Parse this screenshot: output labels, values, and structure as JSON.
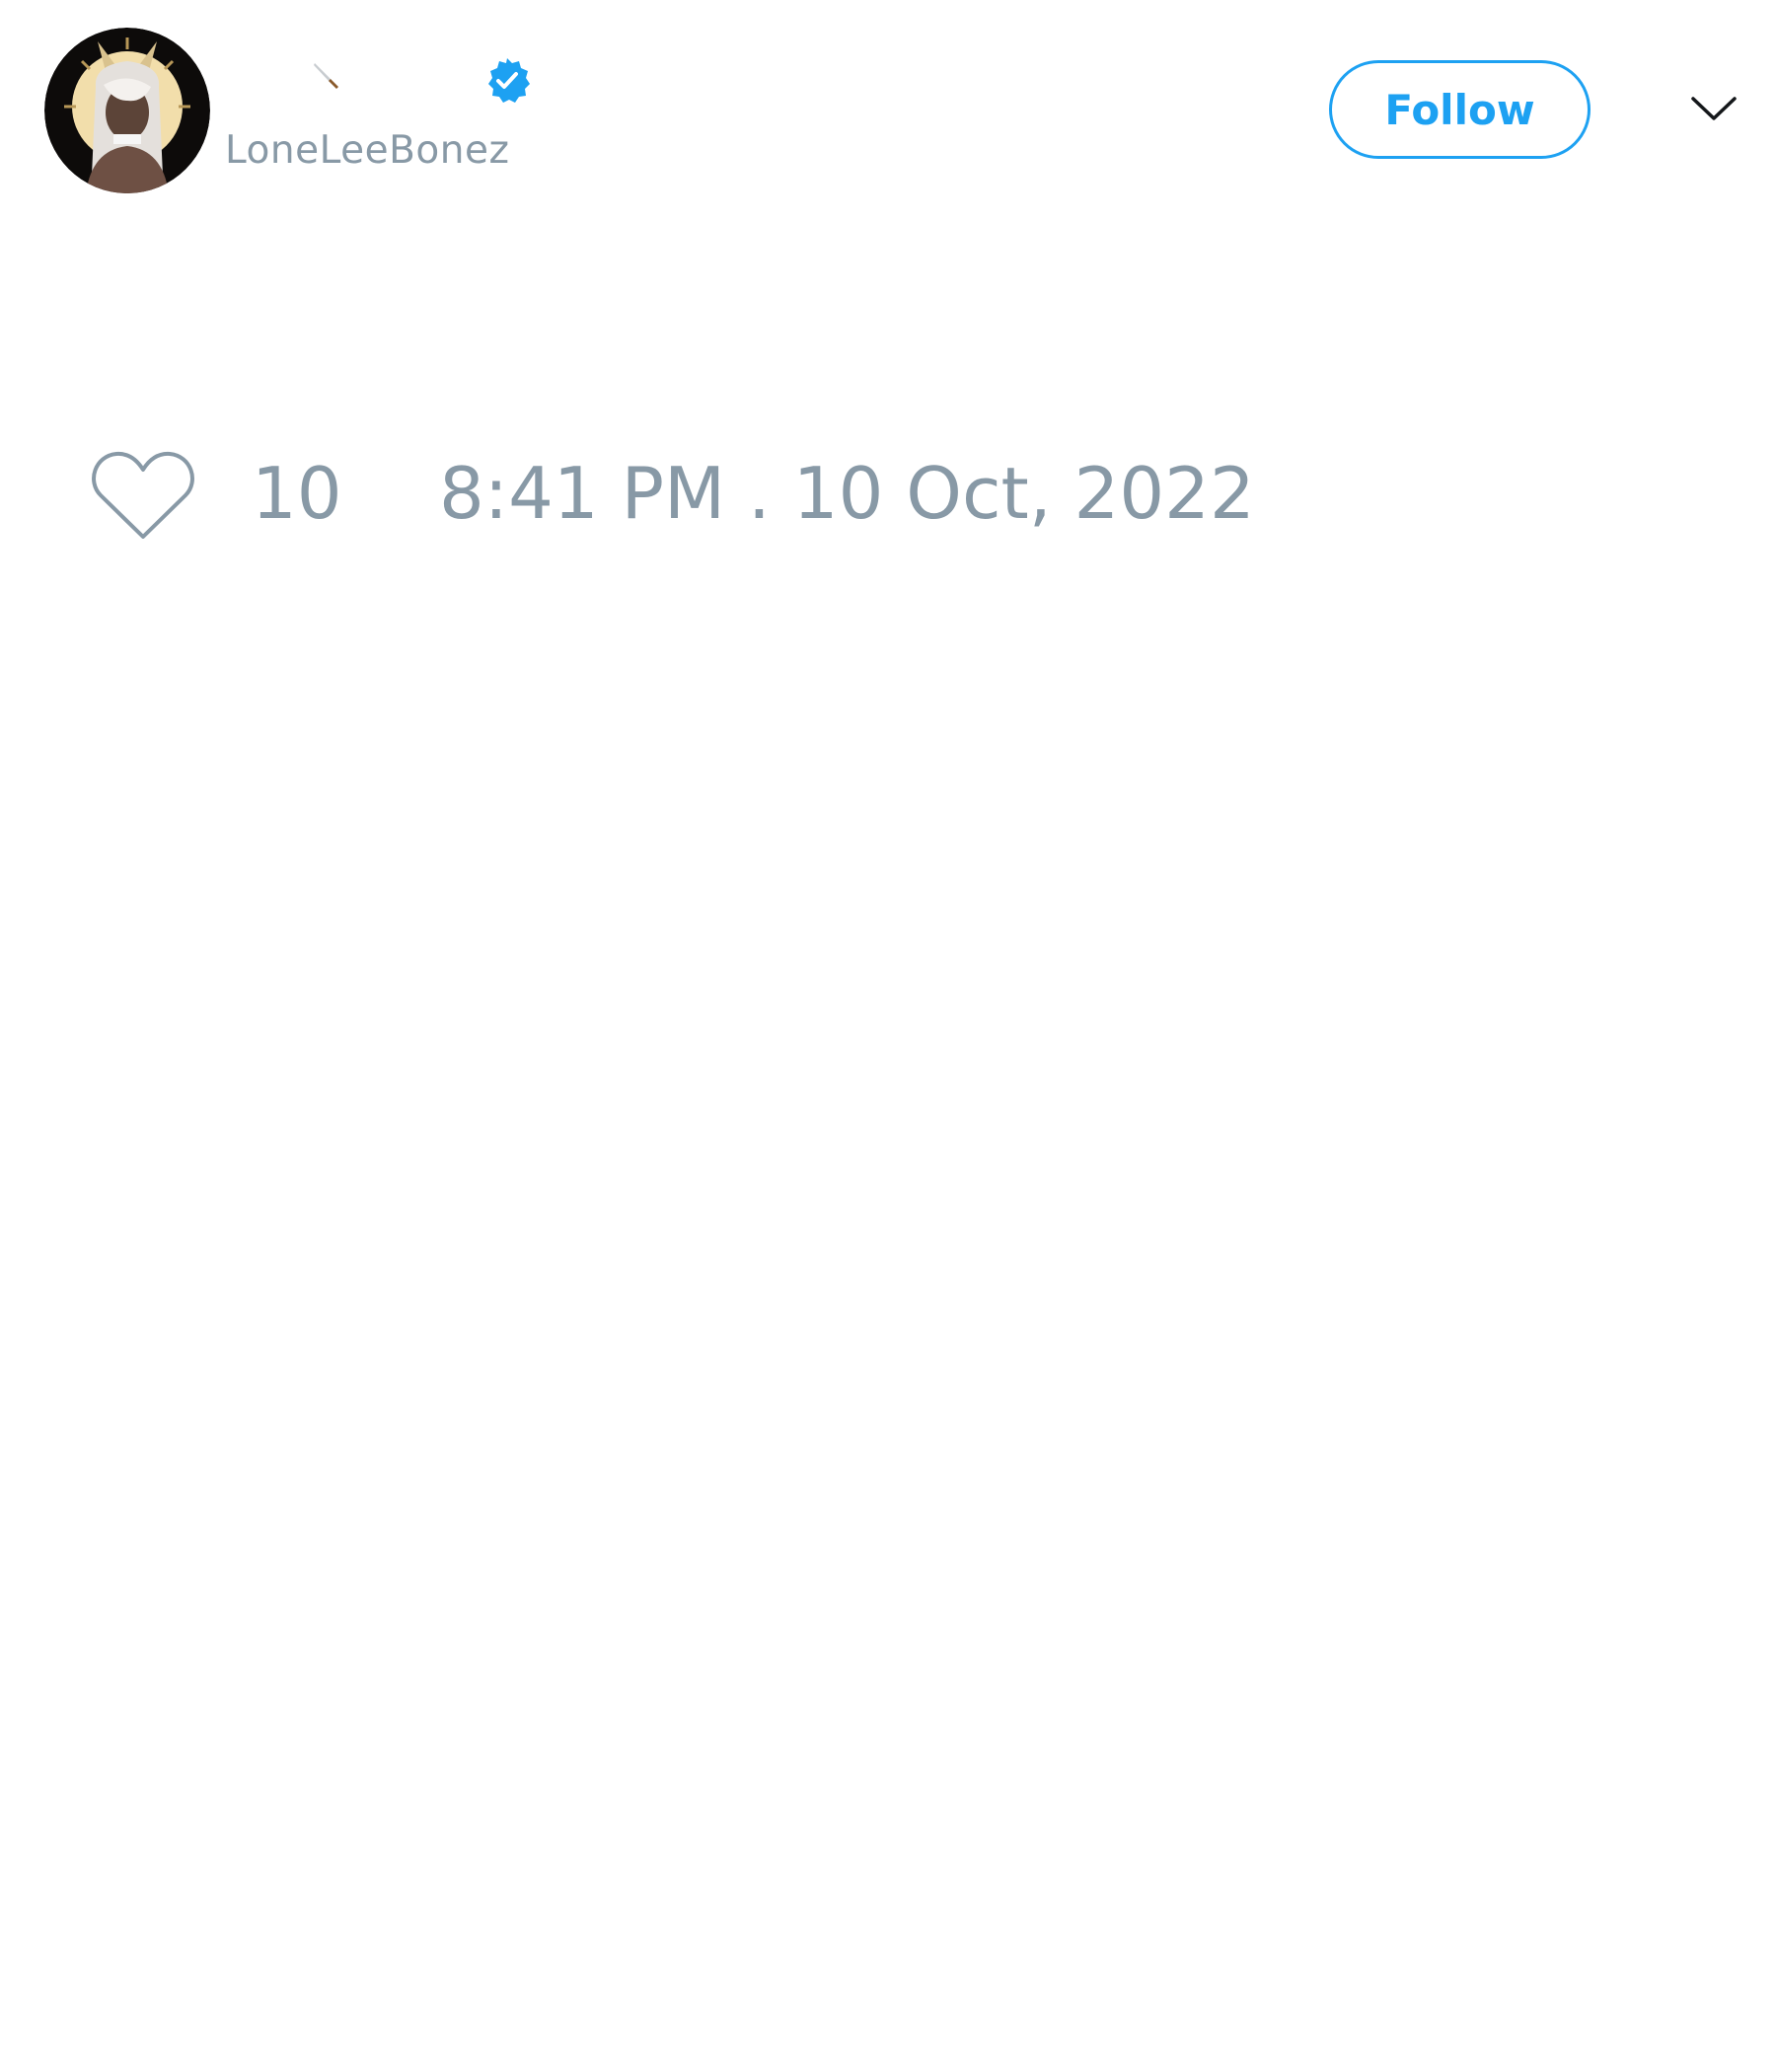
{
  "author": {
    "display_name_emoji": "knife-emoji",
    "verified": true,
    "handle": "LoneLeeBonez"
  },
  "actions": {
    "follow_label": "Follow",
    "more_icon": "chevron-down-icon"
  },
  "stats": {
    "like_icon": "heart-icon",
    "like_count": "10"
  },
  "meta": {
    "timestamp": "8:41 PM . 10 Oct, 2022"
  },
  "colors": {
    "accent": "#1da1f2",
    "muted_text": "#8899a6",
    "background": "#ffffff"
  }
}
